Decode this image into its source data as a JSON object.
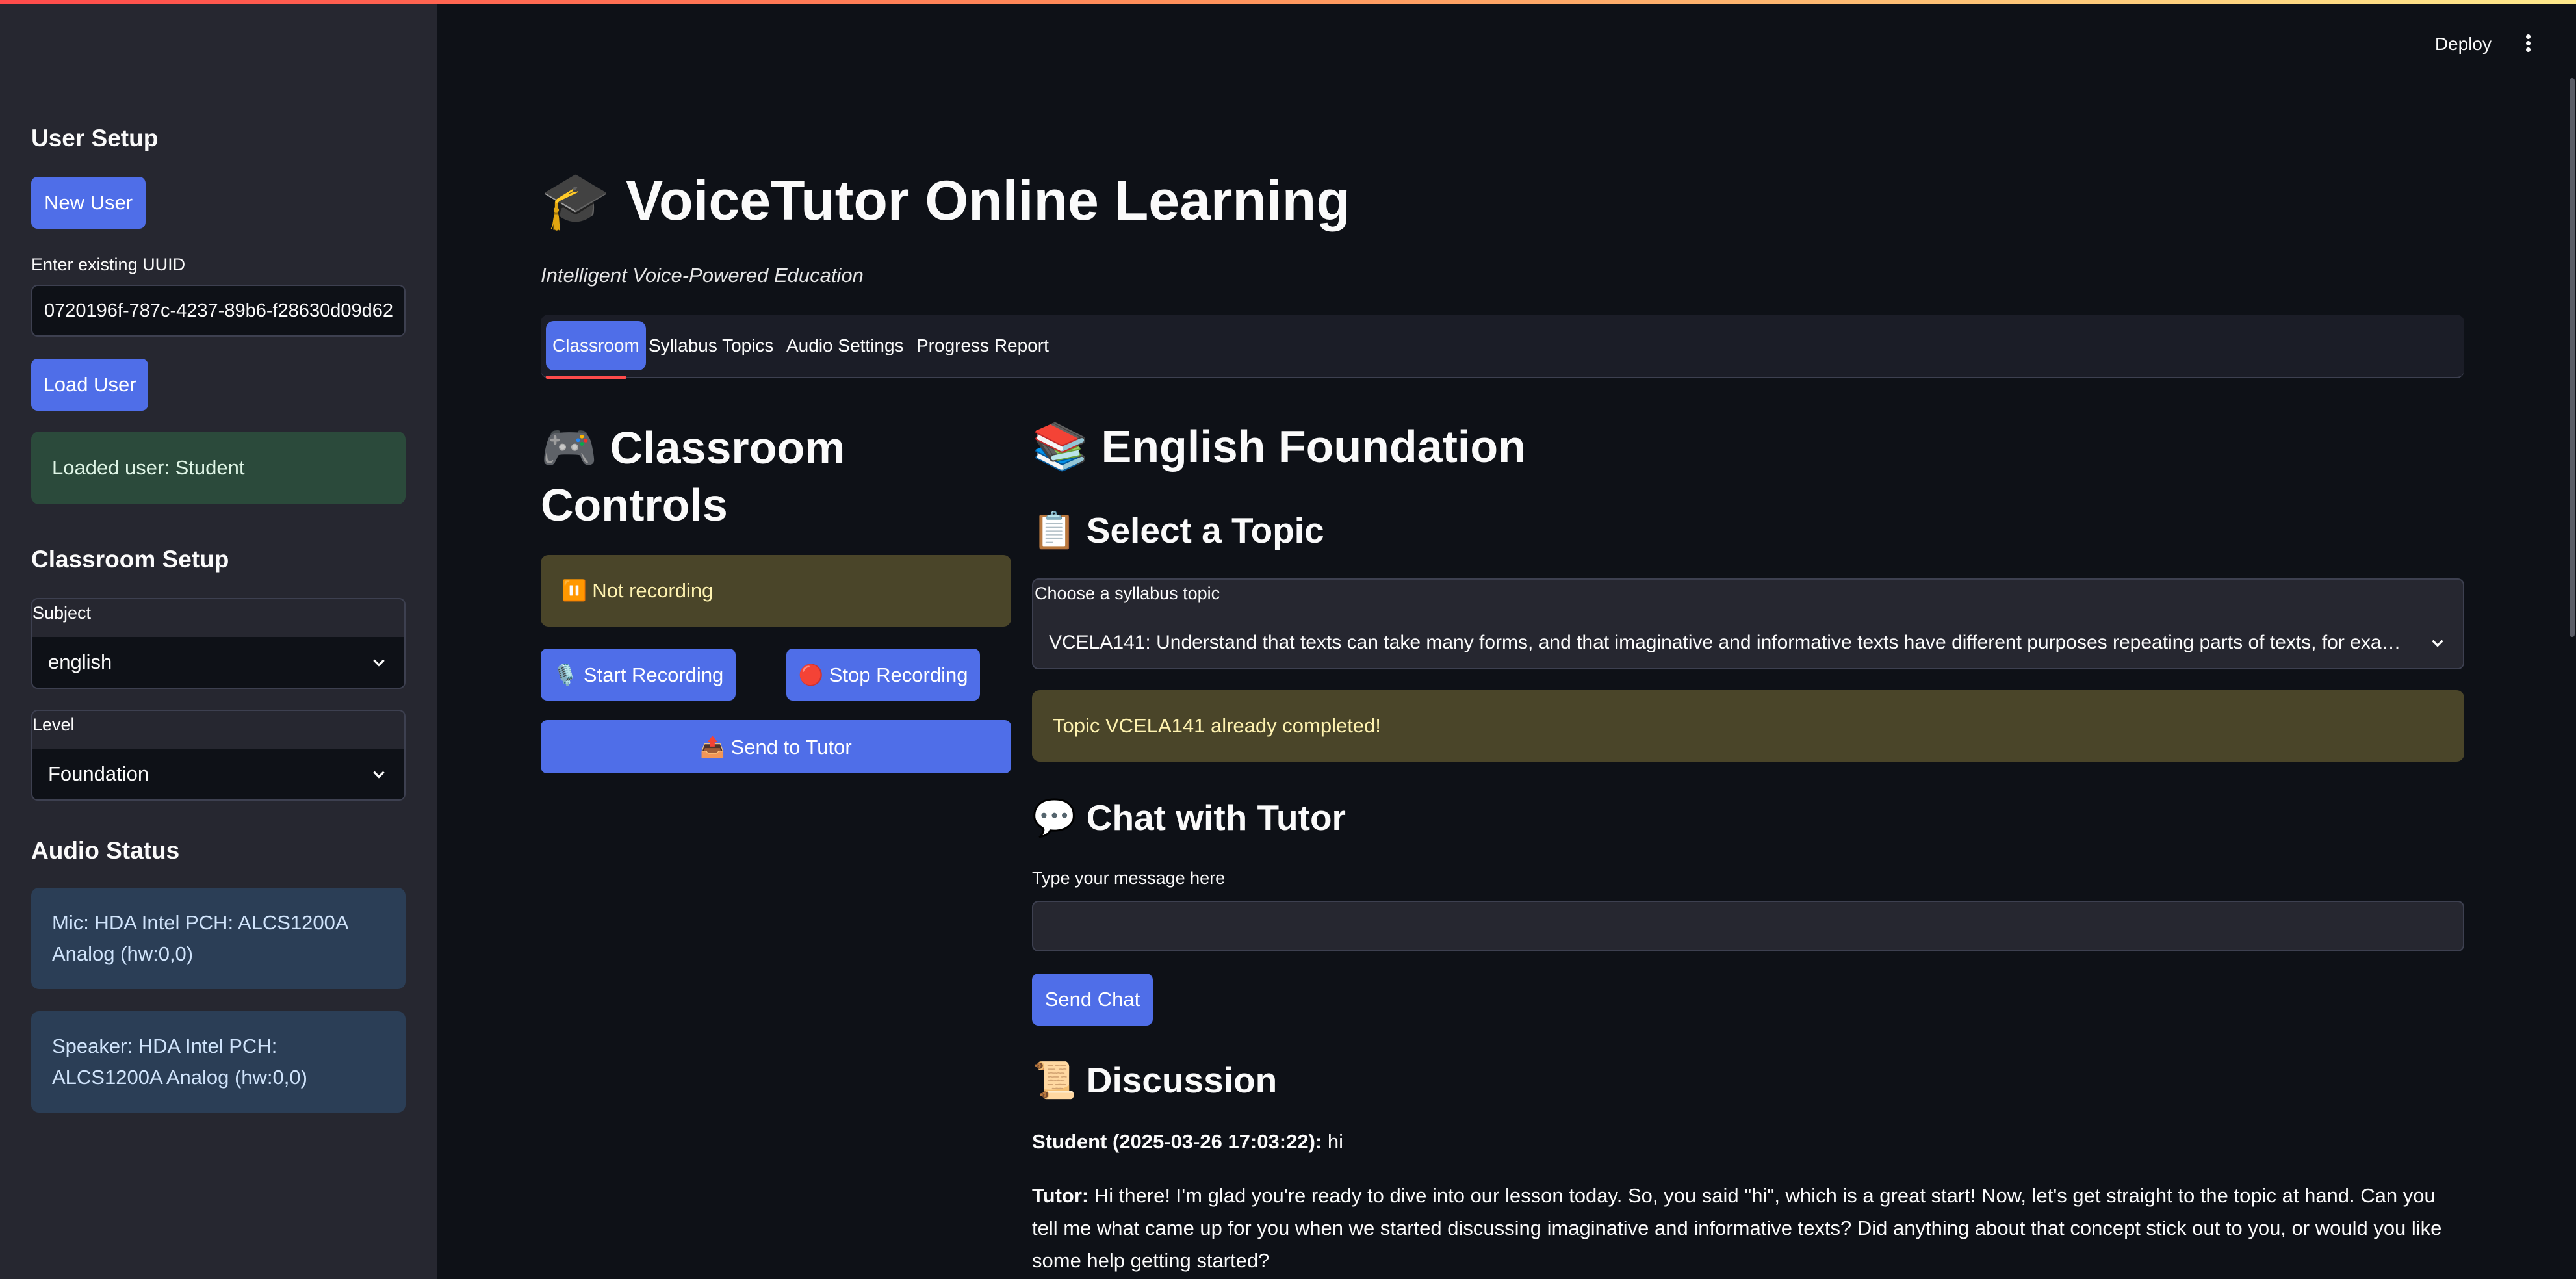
{
  "sidebar": {
    "user_setup_heading": "User Setup",
    "new_user_label": "New User",
    "uuid_label": "Enter existing UUID",
    "uuid_value": "0720196f-787c-4237-89b6-f28630d09d62",
    "load_user_label": "Load User",
    "loaded_message": "Loaded user: Student",
    "classroom_setup_heading": "Classroom Setup",
    "subject_label": "Subject",
    "subject_value": "english",
    "level_label": "Level",
    "level_value": "Foundation",
    "audio_status_heading": "Audio Status",
    "mic_status": "Mic: HDA Intel PCH: ALCS1200A Analog (hw:0,0)",
    "speaker_status": "Speaker: HDA Intel PCH: ALCS1200A Analog (hw:0,0)"
  },
  "header": {
    "deploy_label": "Deploy"
  },
  "main": {
    "title": "🎓 VoiceTutor Online Learning",
    "subtitle": "Intelligent Voice-Powered Education",
    "tabs": [
      {
        "label": "Classroom"
      },
      {
        "label": "Syllabus Topics"
      },
      {
        "label": "Audio Settings"
      },
      {
        "label": "Progress Report"
      }
    ],
    "controls": {
      "heading_line1": "🎮 Classroom",
      "heading_line2": "Controls",
      "recording_status": "⏸️ Not recording",
      "start_label": "🎙️ Start Recording",
      "stop_label": "🔴 Stop Recording",
      "send_label": "📤 Send to Tutor"
    },
    "course": {
      "heading": "📚 English Foundation",
      "select_heading": "📋 Select a Topic",
      "topic_label": "Choose a syllabus topic",
      "topic_value": "VCELA141: Understand that texts can take many forms, and that imaginative and informative texts have different purposes repeating parts of texts, for exa…",
      "completed_message": "Topic VCELA141 already completed!"
    },
    "chat": {
      "heading": "💬 Chat with Tutor",
      "input_label": "Type your message here",
      "input_value": "",
      "send_label": "Send Chat"
    },
    "discussion": {
      "heading": "📜 Discussion",
      "messages": [
        {
          "speaker": "Student (2025-03-26 17:03:22):",
          "text": " hi"
        },
        {
          "speaker": "Tutor:",
          "text": " Hi there! I'm glad you're ready to dive into our lesson today. So, you said \"hi\", which is a great start! Now, let's get straight to the topic at hand. Can you tell me what came up for you when we started discussing imaginative and informative texts? Did anything about that concept stick out to you, or would you like some help getting started?"
        }
      ]
    }
  },
  "colors": {
    "accent": "#4f6ee8",
    "success_bg": "#2b4a3b",
    "warning_bg": "#4a4529",
    "info_bg": "#2b3e56"
  }
}
